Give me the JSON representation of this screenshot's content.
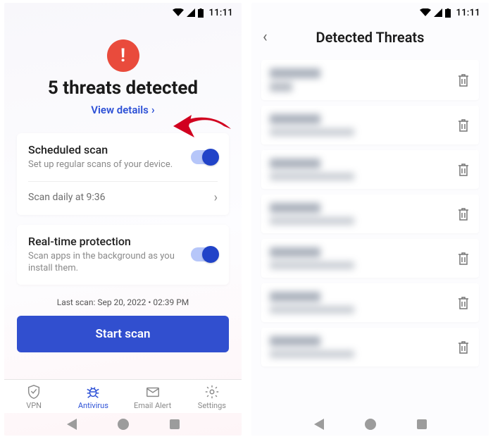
{
  "status": {
    "time": "11:11"
  },
  "screenA": {
    "headline": "5 threats detected",
    "view_details": "View details",
    "scheduled": {
      "title": "Scheduled scan",
      "subtitle": "Set up regular scans of your device.",
      "time_row": "Scan daily at 9:36"
    },
    "realtime": {
      "title": "Real-time protection",
      "subtitle": "Scan apps in the background as you install them."
    },
    "last_scan": "Last scan: Sep 20, 2022 • 02:39 PM",
    "start_scan": "Start scan",
    "tabs": {
      "vpn": "VPN",
      "antivirus": "Antivirus",
      "email": "Email Alert",
      "settings": "Settings"
    }
  },
  "screenB": {
    "title": "Detected Threats",
    "threat_count": 7
  },
  "colors": {
    "accent": "#2c50d6",
    "danger": "#e94b3c",
    "primary_btn": "#314fcf"
  }
}
